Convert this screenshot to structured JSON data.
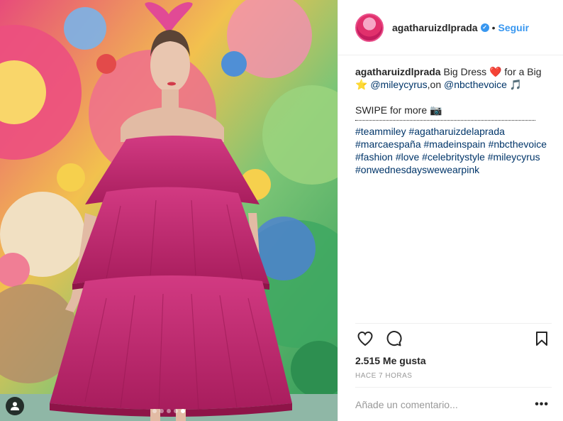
{
  "post": {
    "username": "agatharuizdlprada",
    "verified_badge": "✓",
    "separator": "•",
    "follow_label": "Seguir",
    "caption": {
      "username": "agatharuizdlprada",
      "text_1": " Big Dress ",
      "heart_emoji": "❤️",
      "text_2": " for a Big",
      "star_emoji": "⭐",
      "mention_1": " @mileycyrus",
      "text_3": ",on ",
      "mention_2": "@nbcthevoice",
      "note_emoji": " 🎵",
      "swipe_text": "SWIPE for more ",
      "camera_emoji": "📷",
      "hashtags": "#teammiley #agatharuizdelaprada #marcaespaña #madeinspain #nbcthevoice #fashion #love #celebritystyle #mileycyrus #onwednesdayswewearpink"
    },
    "likes": "2.515 Me gusta",
    "time": "HACE 7 HORAS",
    "comment_placeholder": "Añade un comentario...",
    "more_label": "•••"
  },
  "carousel": {
    "count": 5,
    "active_index": 4
  },
  "icons": {
    "like": "heart-icon",
    "comment": "comment-icon",
    "save": "bookmark-icon",
    "user_tag": "user-icon"
  },
  "colors": {
    "accent_blue": "#3897f0",
    "hashtag": "#003569",
    "dress": "#c2246f",
    "muted_text": "#999999"
  }
}
